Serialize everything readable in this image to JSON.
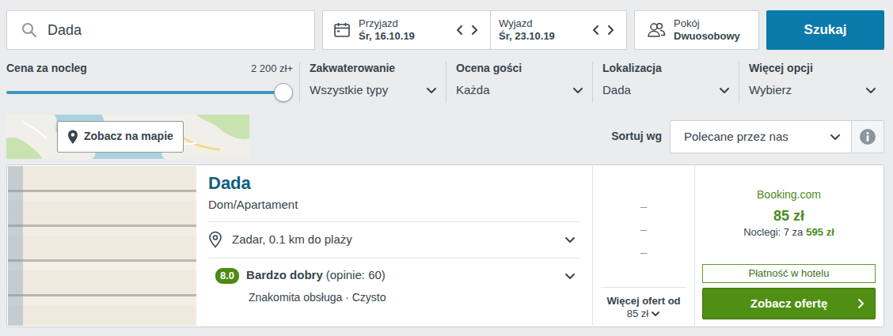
{
  "search": {
    "value": "Dada"
  },
  "dates": [
    {
      "label": "Przyjazd",
      "value": "Śr, 16.10.19"
    },
    {
      "label": "Wyjazd",
      "value": "Śr, 23.10.19"
    }
  ],
  "room": {
    "label": "Pokój",
    "value": "Dwuosobowy"
  },
  "search_button": "Szukaj",
  "price_filter": {
    "label": "Cena za nocleg",
    "reading": "2 200 zł+",
    "level": 1
  },
  "filters": [
    {
      "label": "Zakwaterowanie",
      "value": "Wszystkie typy"
    },
    {
      "label": "Ocena gości",
      "value": "Każda"
    },
    {
      "label": "Lokalizacja",
      "value": "Dada"
    },
    {
      "label": "Więcej opcji",
      "value": "Wybierz"
    }
  ],
  "map_button": "Zobacz na mapie",
  "sort": {
    "label": "Sortuj wg",
    "value": "Polecane przez nas"
  },
  "results": [
    {
      "name": "Dada",
      "type": "Dom/Apartament",
      "location": "Zadar, 0.1 km do plaży",
      "rating": "8.0",
      "rating_label": "Bardzo dobry",
      "reviews": "(opinie: 60)",
      "highlights": "Znakomita obsługa · Czysto",
      "alt_prices": [
        "–",
        "–",
        "–"
      ],
      "more_offers": {
        "label": "Więcej ofert od",
        "price": "85 zł"
      },
      "provider": "Booking.com",
      "price": "85 zł",
      "nights": "Noclegi: 7 za",
      "total": "595 zł",
      "payment": "Płatność w hotelu",
      "cta": "Zobacz ofertę"
    }
  ]
}
